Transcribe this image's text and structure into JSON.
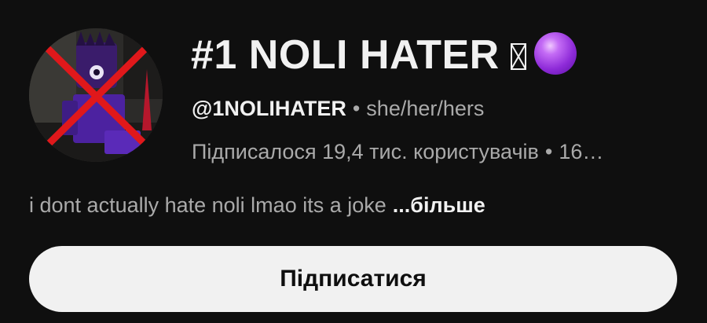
{
  "channel": {
    "name": "#1 NOLI HATER",
    "name_emoji_icons": [
      "missing-glyph-icon",
      "purple-circle-icon"
    ],
    "handle": "@1NOLIHATER",
    "separator": "•",
    "pronouns": "she/her/hers",
    "subscribers": "Підписалося 19,4 тис. користувачів",
    "stats_tail": "16…",
    "description": "i dont actually hate noli lmao its a joke",
    "more_label": "...більше"
  },
  "actions": {
    "subscribe_label": "Підписатися"
  },
  "colors": {
    "background": "#0f0f0f",
    "primary_text": "#f1f1f1",
    "secondary_text": "#aaaaaa",
    "button_bg": "#f1f1f1",
    "avatar_cross": "#e0181b",
    "emoji_purple": "#a33ee8"
  }
}
